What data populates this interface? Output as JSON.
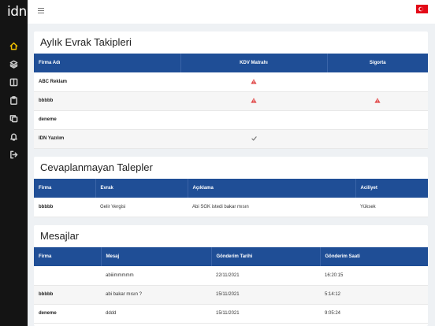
{
  "app": {
    "logo": "idn"
  },
  "sidebar": {
    "items": [
      {
        "name": "home-icon"
      },
      {
        "name": "layers-icon"
      },
      {
        "name": "columns-icon"
      },
      {
        "name": "clipboard-icon"
      },
      {
        "name": "copy-icon"
      },
      {
        "name": "bell-icon"
      },
      {
        "name": "logout-icon"
      }
    ],
    "active_color": "#f2c200"
  },
  "topbar": {
    "flag": "turkey-flag-icon"
  },
  "evrak": {
    "title": "Aylık Evrak Takipleri",
    "columns": [
      "Firma Adı",
      "KDV Matrahı",
      "Sigorta"
    ],
    "rows": [
      {
        "firma": "ABC Reklam",
        "kdv": "warning",
        "sigorta": ""
      },
      {
        "firma": "bbbbb",
        "kdv": "warning",
        "sigorta": "warning"
      },
      {
        "firma": "deneme",
        "kdv": "",
        "sigorta": ""
      },
      {
        "firma": "IDN Yazılım",
        "kdv": "check",
        "sigorta": ""
      }
    ]
  },
  "talepler": {
    "title": "Cevaplanmayan Talepler",
    "columns": [
      "Firma",
      "Evrak",
      "Açıklama",
      "Aciliyet"
    ],
    "rows": [
      {
        "firma": "bbbbb",
        "evrak": "Gelir Vergisi",
        "aciklama": "Abi SGK istedi bakar mısın",
        "aciliyet": "Yüksek"
      }
    ]
  },
  "mesajlar": {
    "title": "Mesajlar",
    "columns": [
      "Firma",
      "Mesaj",
      "Gönderim Tarihi",
      "Gönderim Saati"
    ],
    "rows": [
      {
        "firma": "",
        "mesaj": "abiiimmmmm",
        "tarih": "22/11/2021",
        "saat": "16:20:15"
      },
      {
        "firma": "bbbbb",
        "mesaj": "abi bakar mısın ?",
        "tarih": "15/11/2021",
        "saat": "5:14:12"
      },
      {
        "firma": "deneme",
        "mesaj": "dddd",
        "tarih": "15/11/2021",
        "saat": "9:05:24"
      }
    ]
  },
  "colors": {
    "header": "#1f4e96",
    "warning": "#e04848",
    "check": "#777777",
    "sidebar": "#141414"
  }
}
